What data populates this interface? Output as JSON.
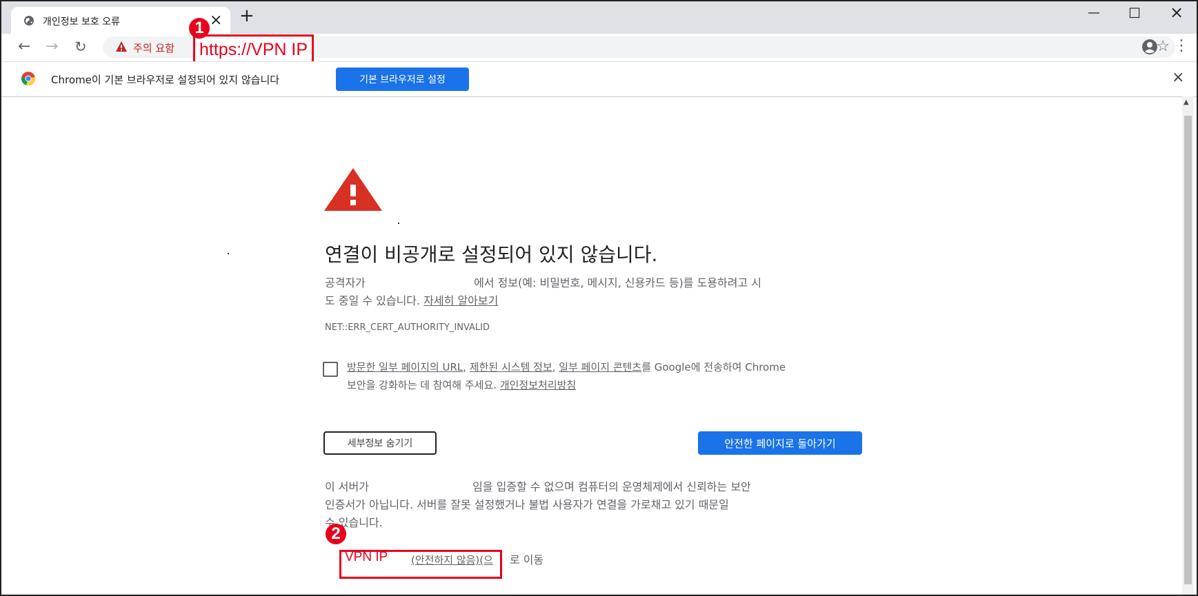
{
  "tab": {
    "title": "개인정보 보호 오류"
  },
  "toolbar": {
    "security_warning": "주의 요함",
    "url": "https://VPN IP"
  },
  "infobar": {
    "message": "Chrome이 기본 브라우저로 설정되어 있지 않습니다",
    "set_default_label": "기본 브라우저로 설정"
  },
  "interstitial": {
    "headline": "연결이 비공개로 설정되어 있지 않습니다.",
    "para1_start": "공격자가",
    "para1_mid": "에서 정보(예: 비밀번호, 메시지, 신용카드 등)를 도용하려고 시",
    "para1_end": "도 중일 수 있습니다.",
    "learn_more": "자세히 알아보기",
    "error_code": "NET::ERR_CERT_AUTHORITY_INVALID",
    "optin_link1": "방문한 일부 페이지의 URL",
    "optin_sep1": ", ",
    "optin_link2": "제한된 시스템 정보",
    "optin_sep2": ", ",
    "optin_link3": "일부 페이지 콘텐츠",
    "optin_rest": "를 Google에 전송하여 Chrome",
    "optin_line2": "보안을 강화하는 데 참여해 주세요.",
    "privacy_link": "개인정보처리방침",
    "hide_details_label": "세부정보 숨기기",
    "back_to_safety_label": "안전한 페이지로 돌아가기",
    "detail_start": "이 서버가",
    "detail_mid": "임을 입증할 수 없으며 컴퓨터의 운영체제에서 신뢰하는 보안",
    "detail_line2": "인증서가 아닙니다. 서버를 잘못 설정했거나 불법 사용자가 연결을 가로채고 있기 때문일",
    "detail_line3": "수 있습니다.",
    "proceed_host": "VPN IP",
    "proceed_link": "(안전하지 않음)(으",
    "proceed_tail": "로 이동"
  },
  "annotations": {
    "badge1": "1",
    "badge2": "2"
  },
  "colors": {
    "accent": "#1a73e8",
    "annotation_red": "#e8001c",
    "warning_red": "#d93025"
  }
}
